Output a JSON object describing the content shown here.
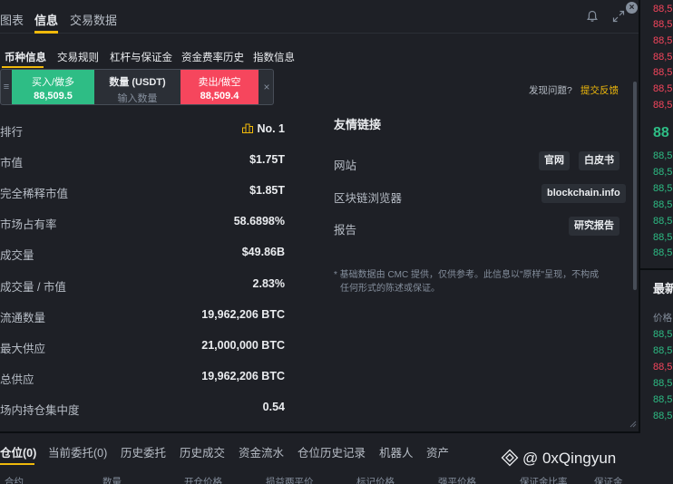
{
  "top_tabs": [
    "图表",
    "信息",
    "交易数据"
  ],
  "sub_tabs": [
    "币种信息",
    "交易规则",
    "杠杆与保证金",
    "资金费率历史",
    "指数信息"
  ],
  "trade_widget": {
    "buy_label": "买入/做多",
    "buy_price": "88,509.5",
    "qty_label": "数量 (USDT)",
    "qty_placeholder": "输入数量",
    "sell_label": "卖出/做空",
    "sell_price": "88,509.4"
  },
  "feedback": {
    "question": "发现问题?",
    "link": "提交反馈"
  },
  "stats": [
    {
      "label": "排行",
      "value": "No. 1"
    },
    {
      "label": "市值",
      "value": "$1.75T"
    },
    {
      "label": "完全稀释市值",
      "value": "$1.85T"
    },
    {
      "label": "市场占有率",
      "value": "58.6898%"
    },
    {
      "label": "成交量",
      "value": "$49.86B"
    },
    {
      "label": "成交量 / 市值",
      "value": "2.83%"
    },
    {
      "label": "流通数量",
      "value": "19,962,206 BTC"
    },
    {
      "label": "最大供应",
      "value": "21,000,000 BTC"
    },
    {
      "label": "总供应",
      "value": "19,962,206 BTC"
    },
    {
      "label": "场内持仓集中度",
      "value": "0.54"
    }
  ],
  "links": {
    "title": "友情链接",
    "website_label": "网站",
    "website_chips": [
      "官网",
      "白皮书"
    ],
    "explorer_label": "区块链浏览器",
    "explorer_chip": "blockchain.info",
    "report_label": "报告",
    "report_chip": "研究报告",
    "disclaimer_line1": "* 基础数据由 CMC 提供，仅供参考。此信息以\"原样\"呈现，不构成",
    "disclaimer_line2": "任何形式的陈述或保证。"
  },
  "right_panel": {
    "ask_prices": [
      "88,5",
      "88,5",
      "88,5",
      "88,5",
      "88,5",
      "88,5",
      "88,5"
    ],
    "last_price": "88",
    "bid_prices": [
      "88,5",
      "88,5",
      "88,5",
      "88,5",
      "88,5",
      "88,5",
      "88,5"
    ],
    "trades_title": "最新",
    "trades_header": "价格",
    "trade_prices": [
      "88,5",
      "88,5",
      "88,5",
      "88,5",
      "88,5",
      "88,5"
    ]
  },
  "bottom_tabs": [
    "仓位(0)",
    "当前委托(0)",
    "历史委托",
    "历史成交",
    "资金流水",
    "仓位历史记录",
    "机器人",
    "资产"
  ],
  "bottom_columns": [
    "合约",
    "数量",
    "开仓价格",
    "标记价格",
    "损益两平价",
    "强平价格",
    "保证金比率",
    "保证金"
  ],
  "watermark": "@ 0xQingyun",
  "colors": {
    "buy": "#2ebd85",
    "sell": "#f6465d",
    "accent": "#f0b90b"
  }
}
